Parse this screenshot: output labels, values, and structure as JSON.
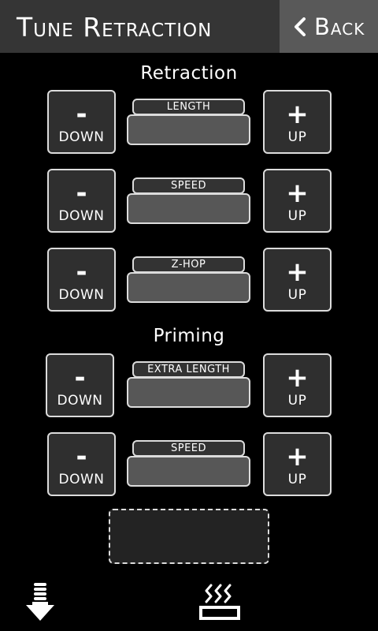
{
  "header": {
    "title": "Tune Retraction",
    "back_label": "Back",
    "back_icon": "chevron-left-icon"
  },
  "sections": {
    "retraction_title": "Retraction",
    "priming_title": "Priming"
  },
  "controls": [
    {
      "id": "retraction-length",
      "field_label": "LENGTH",
      "value": "",
      "down_symbol": "-",
      "down_label": "DOWN",
      "up_symbol": "+",
      "up_label": "UP"
    },
    {
      "id": "retraction-speed",
      "field_label": "SPEED",
      "value": "",
      "down_symbol": "-",
      "down_label": "DOWN",
      "up_symbol": "+",
      "up_label": "UP"
    },
    {
      "id": "retraction-zhop",
      "field_label": "Z-HOP",
      "value": "",
      "down_symbol": "-",
      "down_label": "DOWN",
      "up_symbol": "+",
      "up_label": "UP"
    },
    {
      "id": "priming-extra-length",
      "field_label": "EXTRA LENGTH",
      "value": "",
      "down_symbol": "-",
      "down_label": "DOWN",
      "up_symbol": "+",
      "up_label": "UP"
    },
    {
      "id": "priming-speed",
      "field_label": "SPEED",
      "value": "",
      "down_symbol": "-",
      "down_label": "DOWN",
      "up_symbol": "+",
      "up_label": "UP"
    }
  ],
  "status": {
    "text": ""
  },
  "footer": {
    "left_icon": "extruder-down-icon",
    "right_icon": "heated-bed-icon"
  },
  "colors": {
    "background": "#000000",
    "header": "#353535",
    "back_button": "#595959",
    "button_fill": "#2f2f2f",
    "field_fill": "#575757",
    "border": "#dcdcdc"
  }
}
